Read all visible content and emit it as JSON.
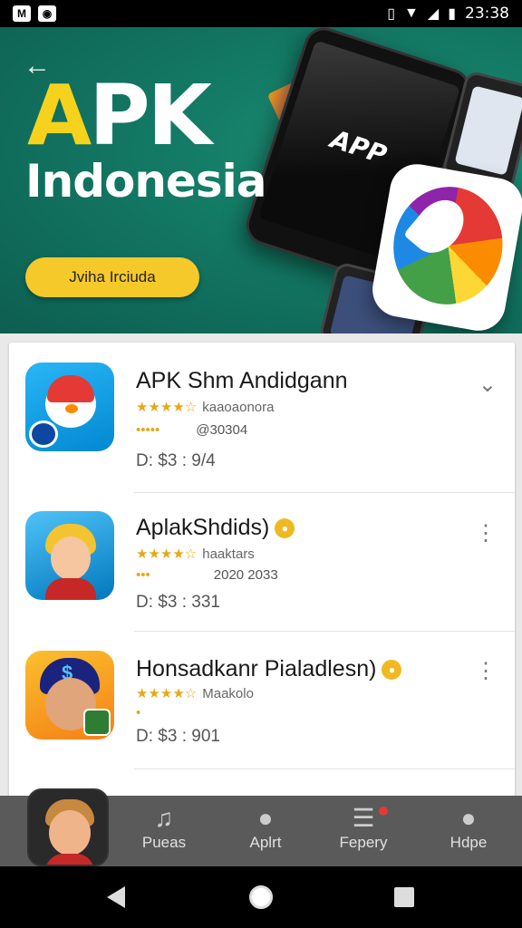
{
  "status_bar": {
    "left_icons": [
      "M",
      "notification-icon"
    ],
    "time": "23:38"
  },
  "banner": {
    "title_first": "A",
    "title_rest": "PK",
    "subtitle": "Indonesia",
    "button_label": "Jviha Irciuda",
    "phone_text": "APP"
  },
  "apps": [
    {
      "title": "APK Shm Andidgann",
      "stars": "★★★★☆",
      "meta1": "kaaoaonora",
      "rating_small": "•••••",
      "meta2": "@30304",
      "size": "D: $3 : 9/4"
    },
    {
      "title": "AplakShdids)",
      "stars": "★★★★☆",
      "meta1": "haaktars",
      "rating_small": "•••",
      "meta2": "2020 2033",
      "size": "D: $3 : 331"
    },
    {
      "title": "Honsadkanr Pialadlesn)",
      "stars": "★★★★☆",
      "meta1": "Maakolo",
      "rating_small": "•",
      "meta2": "",
      "size": "D: $3 : 901"
    }
  ],
  "bottom_nav": [
    {
      "label": "Pueas",
      "icon": "music-note-icon"
    },
    {
      "label": "Aplrt",
      "icon": "person-icon"
    },
    {
      "label": "Fepery",
      "icon": "list-icon"
    },
    {
      "label": "Hdpe",
      "icon": "profile-icon"
    }
  ],
  "colors": {
    "banner_green": "#137a65",
    "accent_yellow": "#f5c92a",
    "star_color": "#e6a817"
  }
}
